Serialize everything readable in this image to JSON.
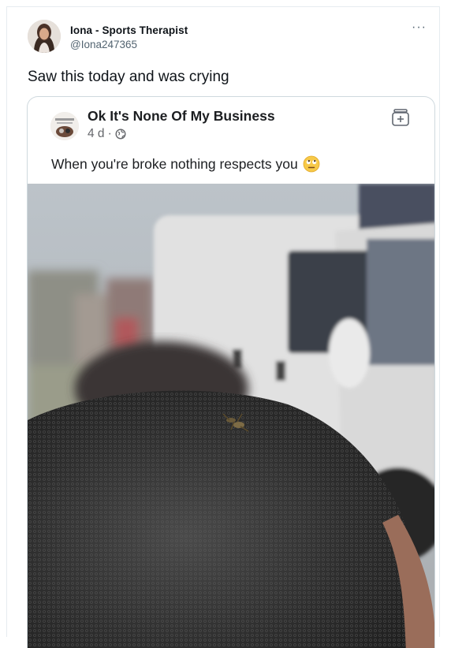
{
  "tweet": {
    "display_name": "Iona - Sports Therapist",
    "handle": "@Iona247365",
    "text": "Saw this today and was crying",
    "more_icon": "more-horizontal-icon"
  },
  "quoted_post": {
    "page_name": "Ok It's None Of My Business",
    "age": "4 d",
    "separator": "·",
    "privacy_icon": "globe-icon",
    "action_icon": "add-to-collection-icon",
    "text": "When you're broke nothing respects you",
    "emoji": "face-with-rolling-eyes"
  },
  "colors": {
    "name": "#0f1419",
    "secondary": "#536471",
    "border": "#cfd9de"
  }
}
